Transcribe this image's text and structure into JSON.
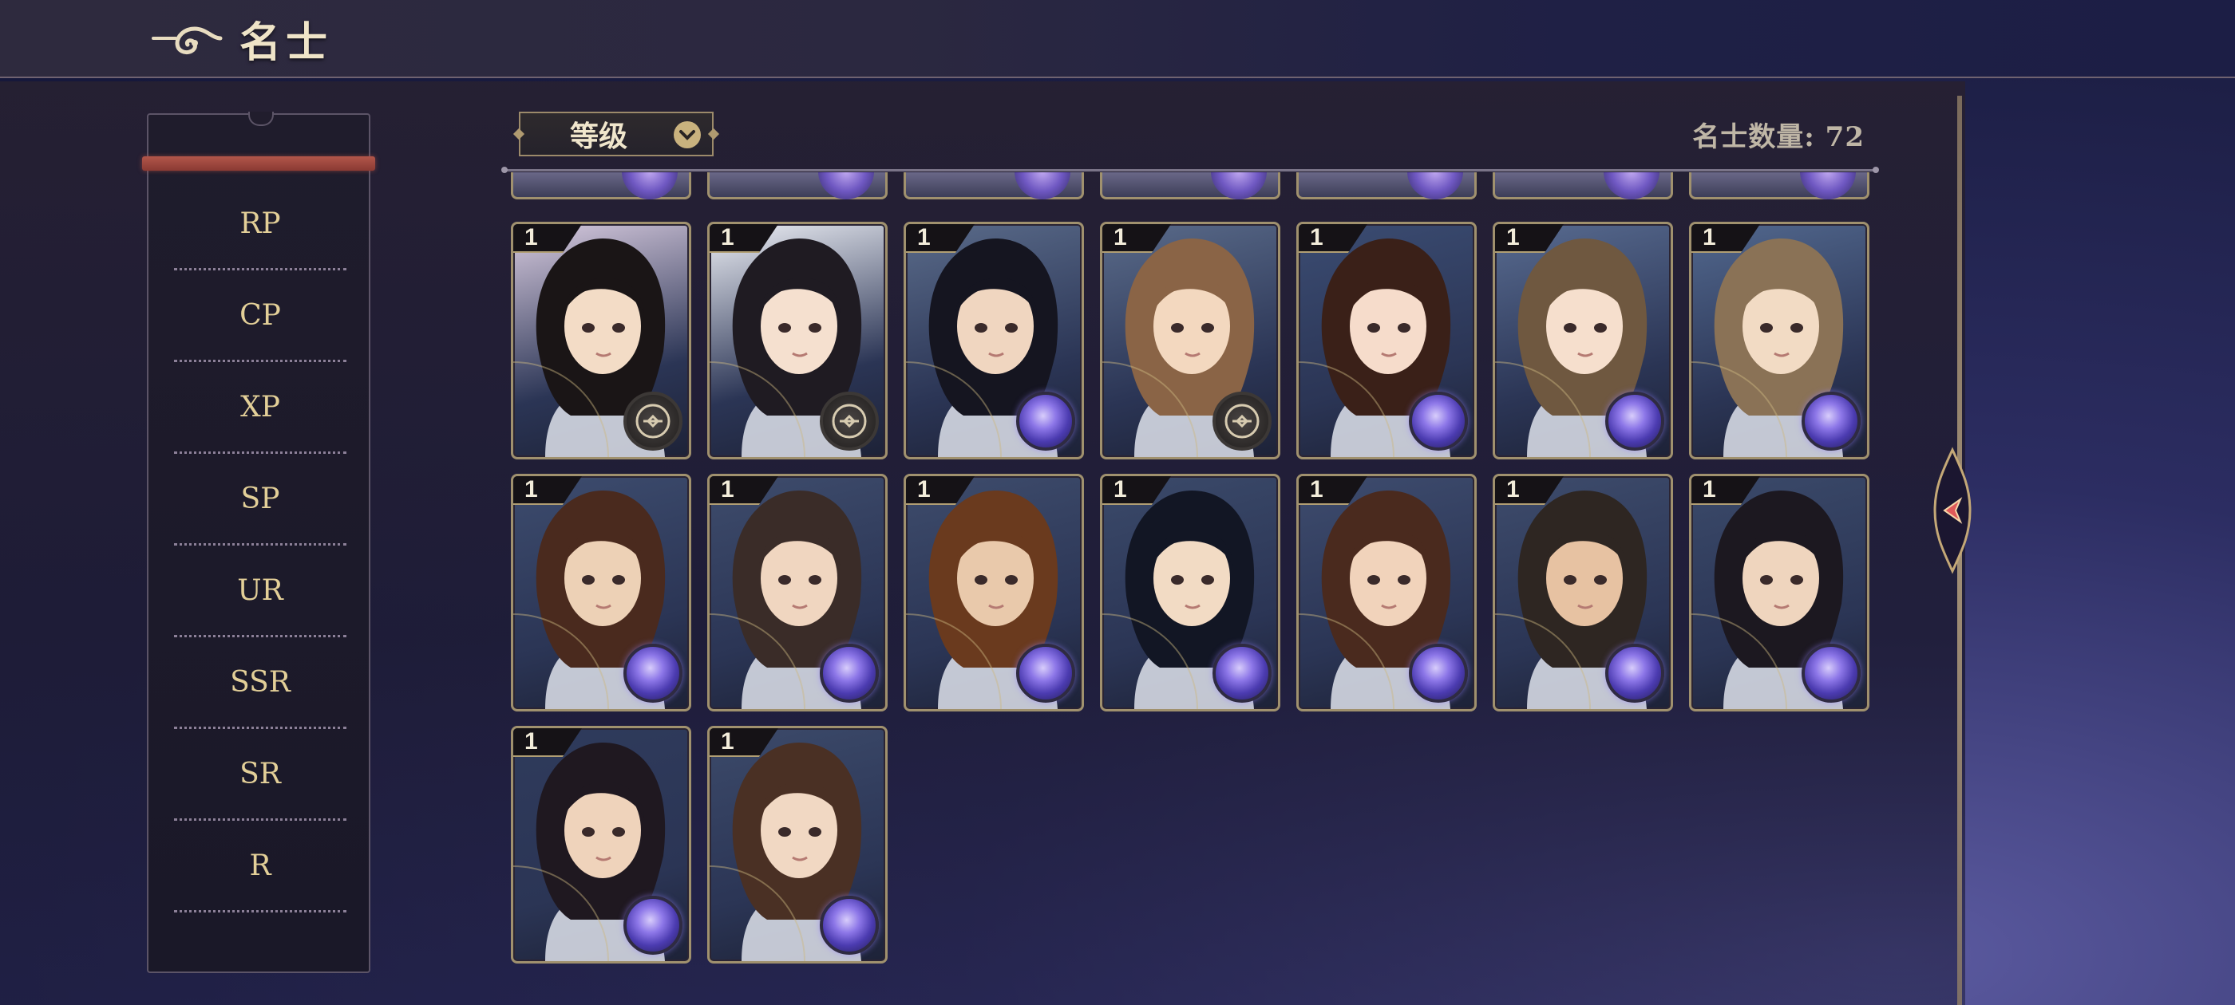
{
  "header": {
    "title": "名士"
  },
  "sidebar": {
    "items": [
      {
        "label": "RP"
      },
      {
        "label": "CP"
      },
      {
        "label": "XP"
      },
      {
        "label": "SP"
      },
      {
        "label": "UR"
      },
      {
        "label": "SSR"
      },
      {
        "label": "SR"
      },
      {
        "label": "R"
      }
    ]
  },
  "filter": {
    "selected": "等级"
  },
  "count": {
    "text": "名士数量: 72"
  },
  "cards": [
    {
      "level": "1",
      "badge": "compass-icon"
    },
    {
      "level": "1",
      "badge": "compass-icon"
    },
    {
      "level": "1",
      "badge": "purple-orb-icon"
    },
    {
      "level": "1",
      "badge": "compass-icon"
    },
    {
      "level": "1",
      "badge": "purple-orb-icon"
    },
    {
      "level": "1",
      "badge": "purple-orb-icon"
    },
    {
      "level": "1",
      "badge": "purple-orb-icon"
    },
    {
      "level": "1",
      "badge": "purple-orb-icon"
    },
    {
      "level": "1",
      "badge": "purple-orb-icon"
    },
    {
      "level": "1",
      "badge": "purple-orb-icon"
    },
    {
      "level": "1",
      "badge": "purple-orb-icon"
    },
    {
      "level": "1",
      "badge": "purple-orb-icon"
    },
    {
      "level": "1",
      "badge": "purple-orb-icon"
    },
    {
      "level": "1",
      "badge": "purple-orb-icon"
    },
    {
      "level": "1",
      "badge": "purple-orb-icon"
    },
    {
      "level": "1",
      "badge": "purple-orb-icon"
    }
  ],
  "colors": {
    "accent_gold": "#d8c08a",
    "active_tab_red": "#b2564a",
    "card_border": "#a0916e"
  }
}
